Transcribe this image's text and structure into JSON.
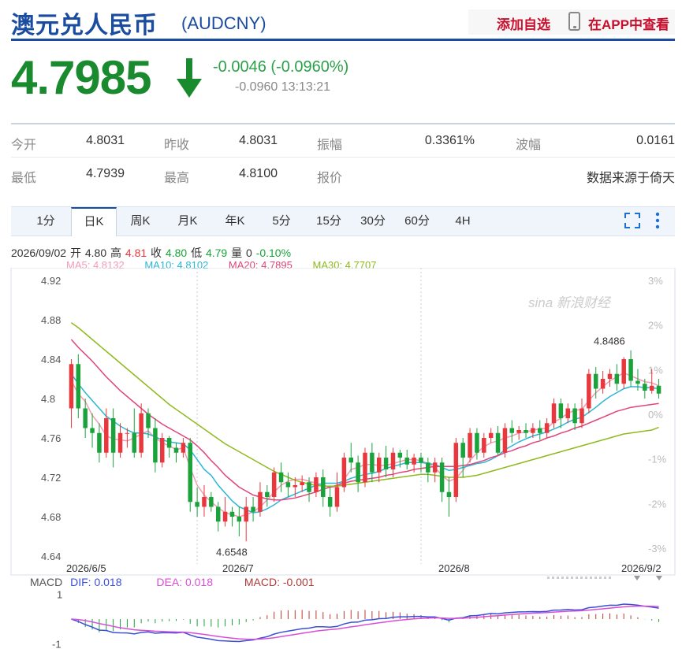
{
  "header": {
    "name": "澳元兑人民币",
    "code": "(AUDCNY)",
    "add_watchlist": "添加自选",
    "view_in_app": "在APP中查看"
  },
  "quote": {
    "price": "4.7985",
    "direction": "down",
    "change": "-0.0046 (-0.0960%)",
    "change_time": "-0.0960 13:13:21",
    "down_color": "#1a8a2e"
  },
  "stats": {
    "open_label": "今开",
    "open": "4.8031",
    "prev_close_label": "昨收",
    "prev_close": "4.8031",
    "amplitude_label": "振幅",
    "amplitude": "0.3361%",
    "wave_label": "波幅",
    "wave": "0.0161",
    "low_label": "最低",
    "low": "4.7939",
    "high_label": "最高",
    "high": "4.8100",
    "quote_label": "报价",
    "source": "数据来源于倚天"
  },
  "tabs": [
    "1分",
    "日K",
    "周K",
    "月K",
    "年K",
    "5分",
    "15分",
    "30分",
    "60分",
    "4H"
  ],
  "active_tab": 1,
  "ohlc": {
    "date": "2026/09/02",
    "open_label": "开",
    "open": "4.80",
    "high_label": "高",
    "high": "4.81",
    "close_label": "收",
    "close": "4.80",
    "low_label": "低",
    "low": "4.79",
    "vol_label": "量",
    "vol": "0",
    "pct": "-0.10%"
  },
  "ma_legend": [
    {
      "text": "MA5: 4.8132",
      "color": "#f29cb4"
    },
    {
      "text": "MA10: 4.8102",
      "color": "#2bb6d6"
    },
    {
      "text": "MA20: 4.7895",
      "color": "#e0457b"
    },
    {
      "text": "MA30: 4.7707",
      "color": "#8fba1e"
    }
  ],
  "macd_legend": {
    "macd_title": "MACD",
    "dif": "DIF: 0.018",
    "dea": "DEA: 0.018",
    "macd": "MACD: -0.001"
  },
  "watermark": "新浪财经",
  "chart_data": {
    "type": "candlestick",
    "x_ticks": [
      "2026/6/5",
      "2026/7",
      "2026/8",
      "2026/9/2"
    ],
    "y_ticks": [
      "4.92",
      "4.88",
      "4.84",
      "4.8",
      "4.76",
      "4.72",
      "4.68",
      "4.64"
    ],
    "ylim": [
      4.64,
      4.92
    ],
    "right_ticks": [
      "3%",
      "2%",
      "1%",
      "0%",
      "-1%",
      "-2%",
      "-3%"
    ],
    "right_ylim": [
      -3,
      3
    ],
    "annotations": [
      {
        "text": "4.6548",
        "value": 4.6548
      },
      {
        "text": "4.8486",
        "value": 4.8486
      }
    ],
    "up_color": "#e8383d",
    "down_color": "#1aa33a",
    "candles": [
      [
        4.79,
        4.835,
        4.84,
        4.77
      ],
      [
        4.835,
        4.79,
        4.845,
        4.78
      ],
      [
        4.79,
        4.77,
        4.8,
        4.76
      ],
      [
        4.77,
        4.765,
        4.785,
        4.75
      ],
      [
        4.765,
        4.745,
        4.775,
        4.735
      ],
      [
        4.745,
        4.78,
        4.79,
        4.74
      ],
      [
        4.78,
        4.745,
        4.79,
        4.73
      ],
      [
        4.745,
        4.765,
        4.775,
        4.74
      ],
      [
        4.765,
        4.765,
        4.77,
        4.75
      ],
      [
        4.765,
        4.745,
        4.79,
        4.74
      ],
      [
        4.745,
        4.785,
        4.795,
        4.74
      ],
      [
        4.785,
        4.77,
        4.79,
        4.76
      ],
      [
        4.77,
        4.735,
        4.78,
        4.725
      ],
      [
        4.735,
        4.76,
        4.765,
        4.73
      ],
      [
        4.76,
        4.75,
        4.762,
        4.74
      ],
      [
        4.75,
        4.745,
        4.755,
        4.735
      ],
      [
        4.745,
        4.755,
        4.76,
        4.74
      ],
      [
        4.755,
        4.695,
        4.76,
        4.685
      ],
      [
        4.695,
        4.69,
        4.71,
        4.68
      ],
      [
        4.69,
        4.7,
        4.712,
        4.68
      ],
      [
        4.7,
        4.69,
        4.705,
        4.685
      ],
      [
        4.69,
        4.675,
        4.695,
        4.665
      ],
      [
        4.675,
        4.685,
        4.7,
        4.67
      ],
      [
        4.685,
        4.68,
        4.69,
        4.67
      ],
      [
        4.68,
        4.675,
        4.69,
        4.66
      ],
      [
        4.675,
        4.69,
        4.7,
        4.655
      ],
      [
        4.69,
        4.685,
        4.7,
        4.675
      ],
      [
        4.685,
        4.705,
        4.715,
        4.68
      ],
      [
        4.705,
        4.7,
        4.712,
        4.69
      ],
      [
        4.7,
        4.725,
        4.73,
        4.695
      ],
      [
        4.725,
        4.715,
        4.735,
        4.705
      ],
      [
        4.715,
        4.71,
        4.725,
        4.7
      ],
      [
        4.71,
        4.712,
        4.72,
        4.7
      ],
      [
        4.712,
        4.715,
        4.722,
        4.705
      ],
      [
        4.715,
        4.705,
        4.72,
        4.695
      ],
      [
        4.705,
        4.72,
        4.725,
        4.7
      ],
      [
        4.72,
        4.7,
        4.728,
        4.69
      ],
      [
        4.7,
        4.69,
        4.71,
        4.68
      ],
      [
        4.69,
        4.71,
        4.725,
        4.685
      ],
      [
        4.71,
        4.74,
        4.745,
        4.705
      ],
      [
        4.74,
        4.735,
        4.755,
        4.725
      ],
      [
        4.735,
        4.715,
        4.742,
        4.705
      ],
      [
        4.715,
        4.745,
        4.75,
        4.71
      ],
      [
        4.745,
        4.725,
        4.755,
        4.715
      ],
      [
        4.725,
        4.74,
        4.745,
        4.715
      ],
      [
        4.74,
        4.728,
        4.752,
        4.72
      ],
      [
        4.728,
        4.745,
        4.75,
        4.72
      ],
      [
        4.745,
        4.74,
        4.748,
        4.73
      ],
      [
        4.74,
        4.733,
        4.748,
        4.728
      ],
      [
        4.733,
        4.74,
        4.744,
        4.725
      ],
      [
        4.74,
        4.735,
        4.745,
        4.725
      ],
      [
        4.735,
        4.725,
        4.74,
        4.715
      ],
      [
        4.725,
        4.735,
        4.74,
        4.715
      ],
      [
        4.735,
        4.705,
        4.74,
        4.695
      ],
      [
        4.705,
        4.7,
        4.72,
        4.68
      ],
      [
        4.7,
        4.755,
        4.76,
        4.695
      ],
      [
        4.755,
        4.74,
        4.76,
        4.72
      ],
      [
        4.74,
        4.765,
        4.77,
        4.735
      ],
      [
        4.765,
        4.745,
        4.77,
        4.738
      ],
      [
        4.745,
        4.76,
        4.765,
        4.74
      ],
      [
        4.76,
        4.765,
        4.77,
        4.755
      ],
      [
        4.765,
        4.745,
        4.772,
        4.742
      ],
      [
        4.745,
        4.77,
        4.775,
        4.74
      ],
      [
        4.77,
        4.765,
        4.778,
        4.755
      ],
      [
        4.765,
        4.768,
        4.772,
        4.758
      ],
      [
        4.768,
        4.765,
        4.775,
        4.76
      ],
      [
        4.765,
        4.77,
        4.775,
        4.76
      ],
      [
        4.77,
        4.765,
        4.778,
        4.758
      ],
      [
        4.765,
        4.775,
        4.78,
        4.76
      ],
      [
        4.775,
        4.795,
        4.8,
        4.77
      ],
      [
        4.795,
        4.78,
        4.8,
        4.77
      ],
      [
        4.78,
        4.79,
        4.795,
        4.775
      ],
      [
        4.79,
        4.775,
        4.795,
        4.768
      ],
      [
        4.775,
        4.79,
        4.8,
        4.77
      ],
      [
        4.79,
        4.825,
        4.83,
        4.785
      ],
      [
        4.825,
        4.81,
        4.832,
        4.8
      ],
      [
        4.81,
        4.82,
        4.828,
        4.805
      ],
      [
        4.82,
        4.825,
        4.83,
        4.812
      ],
      [
        4.825,
        4.815,
        4.835,
        4.808
      ],
      [
        4.815,
        4.84,
        4.842,
        4.81
      ],
      [
        4.84,
        4.818,
        4.849,
        4.812
      ],
      [
        4.818,
        4.815,
        4.83,
        4.808
      ],
      [
        4.815,
        4.808,
        4.82,
        4.8
      ],
      [
        4.808,
        4.813,
        4.83,
        4.805
      ],
      [
        4.813,
        4.805,
        4.82,
        4.8
      ]
    ],
    "ma_series": [
      {
        "name": "MA5",
        "values": [
          4.818,
          4.805,
          4.797,
          4.783,
          4.774,
          4.762,
          4.759,
          4.758,
          4.757,
          4.76,
          4.764,
          4.767,
          4.76,
          4.755,
          4.752,
          4.748,
          4.75,
          4.73,
          4.712,
          4.702,
          4.695,
          4.689,
          4.684,
          4.682,
          4.68,
          4.682,
          4.685,
          4.69,
          4.697,
          4.705,
          4.712,
          4.716,
          4.718,
          4.718,
          4.716,
          4.714,
          4.712,
          4.71,
          4.71,
          4.718,
          4.728,
          4.73,
          4.733,
          4.733,
          4.732,
          4.732,
          4.734,
          4.736,
          4.738,
          4.738,
          4.737,
          4.734,
          4.73,
          4.722,
          4.716,
          4.719,
          4.727,
          4.737,
          4.745,
          4.751,
          4.755,
          4.757,
          4.76,
          4.762,
          4.765,
          4.766,
          4.768,
          4.769,
          4.77,
          4.776,
          4.78,
          4.785,
          4.788,
          4.789,
          4.798,
          4.806,
          4.812,
          4.818,
          4.822,
          4.826,
          4.823,
          4.82,
          4.817,
          4.816,
          4.813
        ]
      },
      {
        "name": "MA10",
        "values": [
          4.825,
          4.815,
          4.806,
          4.798,
          4.79,
          4.782,
          4.777,
          4.772,
          4.768,
          4.765,
          4.765,
          4.764,
          4.761,
          4.758,
          4.756,
          4.755,
          4.754,
          4.748,
          4.738,
          4.728,
          4.722,
          4.712,
          4.704,
          4.696,
          4.69,
          4.687,
          4.684,
          4.685,
          4.688,
          4.692,
          4.697,
          4.7,
          4.703,
          4.706,
          4.709,
          4.712,
          4.714,
          4.714,
          4.714,
          4.716,
          4.719,
          4.721,
          4.723,
          4.724,
          4.726,
          4.729,
          4.731,
          4.733,
          4.735,
          4.735,
          4.735,
          4.734,
          4.733,
          4.73,
          4.727,
          4.728,
          4.73,
          4.732,
          4.734,
          4.735,
          4.738,
          4.742,
          4.748,
          4.752,
          4.756,
          4.759,
          4.762,
          4.764,
          4.766,
          4.769,
          4.772,
          4.776,
          4.779,
          4.781,
          4.786,
          4.791,
          4.797,
          4.802,
          4.806,
          4.81,
          4.812,
          4.812,
          4.811,
          4.811,
          4.81
        ]
      },
      {
        "name": "MA20",
        "values": [
          4.86,
          4.852,
          4.845,
          4.838,
          4.83,
          4.822,
          4.815,
          4.808,
          4.802,
          4.796,
          4.79,
          4.784,
          4.779,
          4.774,
          4.77,
          4.766,
          4.762,
          4.758,
          4.752,
          4.745,
          4.737,
          4.73,
          4.722,
          4.716,
          4.71,
          4.706,
          4.702,
          4.7,
          4.698,
          4.697,
          4.697,
          4.698,
          4.699,
          4.701,
          4.703,
          4.705,
          4.708,
          4.71,
          4.712,
          4.714,
          4.716,
          4.717,
          4.718,
          4.719,
          4.72,
          4.722,
          4.723,
          4.725,
          4.726,
          4.728,
          4.729,
          4.73,
          4.731,
          4.731,
          4.731,
          4.731,
          4.732,
          4.733,
          4.735,
          4.737,
          4.74,
          4.742,
          4.745,
          4.747,
          4.75,
          4.752,
          4.755,
          4.757,
          4.76,
          4.762,
          4.765,
          4.767,
          4.77,
          4.772,
          4.775,
          4.778,
          4.781,
          4.784,
          4.787,
          4.789,
          4.791,
          4.792,
          4.793,
          4.794,
          4.795
        ]
      },
      {
        "name": "MA30",
        "values": [
          4.877,
          4.872,
          4.866,
          4.86,
          4.854,
          4.848,
          4.842,
          4.836,
          4.83,
          4.824,
          4.818,
          4.812,
          4.806,
          4.8,
          4.794,
          4.789,
          4.784,
          4.779,
          4.774,
          4.769,
          4.764,
          4.759,
          4.754,
          4.75,
          4.746,
          4.742,
          4.738,
          4.734,
          4.73,
          4.726,
          4.723,
          4.72,
          4.717,
          4.715,
          4.713,
          4.712,
          4.711,
          4.711,
          4.711,
          4.712,
          4.713,
          4.714,
          4.715,
          4.716,
          4.717,
          4.718,
          4.719,
          4.72,
          4.721,
          4.722,
          4.723,
          4.723,
          4.722,
          4.721,
          4.72,
          4.72,
          4.72,
          4.721,
          4.722,
          4.724,
          4.726,
          4.728,
          4.73,
          4.732,
          4.734,
          4.736,
          4.738,
          4.74,
          4.742,
          4.744,
          4.746,
          4.748,
          4.75,
          4.752,
          4.754,
          4.756,
          4.758,
          4.76,
          4.762,
          4.764,
          4.765,
          4.766,
          4.767,
          4.768,
          4.7707
        ]
      }
    ],
    "macd_ticks": [
      "1",
      "-1"
    ],
    "macd_ylim": [
      -1.2,
      1.2
    ]
  }
}
